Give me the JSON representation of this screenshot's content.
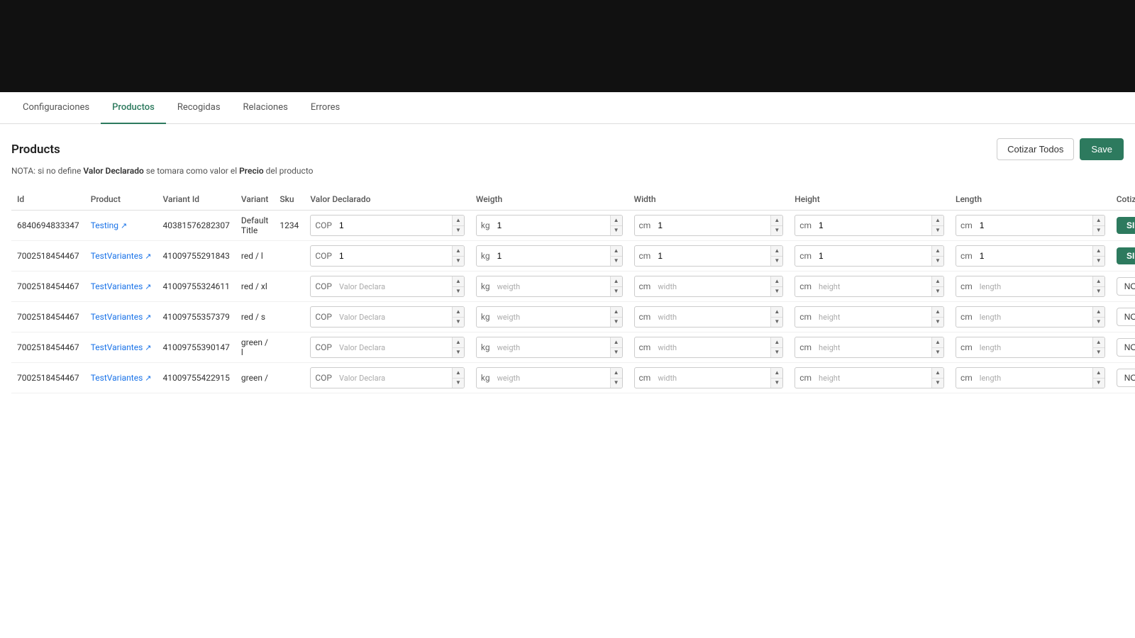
{
  "topBar": {},
  "nav": {
    "tabs": [
      {
        "id": "configuraciones",
        "label": "Configuraciones",
        "active": false
      },
      {
        "id": "productos",
        "label": "Productos",
        "active": true
      },
      {
        "id": "recogidas",
        "label": "Recogidas",
        "active": false
      },
      {
        "id": "relaciones",
        "label": "Relaciones",
        "active": false
      },
      {
        "id": "errores",
        "label": "Errores",
        "active": false
      }
    ]
  },
  "page": {
    "title": "Products",
    "nota_prefix": "NOTA: si no define ",
    "nota_bold1": "Valor Declarado",
    "nota_mid": " se tomara como valor el ",
    "nota_bold2": "Precio",
    "nota_suffix": " del producto",
    "btn_cotizar": "Cotizar Todos",
    "btn_save": "Save"
  },
  "table": {
    "headers": [
      "Id",
      "Product",
      "Variant Id",
      "Variant",
      "Sku",
      "Valor Declarado",
      "Weigth",
      "Width",
      "Height",
      "Length",
      "Cotizable"
    ],
    "rows": [
      {
        "id": "6840694833347",
        "product": "Testing",
        "product_link": true,
        "variant_id": "40381576282307",
        "variant": "Default Title",
        "sku": "1234",
        "valor_unit": "COP",
        "valor_value": "1",
        "valor_placeholder": "",
        "weigth_unit": "kg",
        "weigth_value": "1",
        "weigth_placeholder": "",
        "width_unit": "cm",
        "width_value": "1",
        "width_placeholder": "",
        "height_unit": "cm",
        "height_value": "1",
        "height_placeholder": "",
        "length_unit": "cm",
        "length_value": "1",
        "length_placeholder": "",
        "cotizable": "SI",
        "cotizable_active": true
      },
      {
        "id": "7002518454467",
        "product": "TestVariantes",
        "product_link": true,
        "variant_id": "41009755291843",
        "variant": "red / l",
        "sku": "",
        "valor_unit": "COP",
        "valor_value": "1",
        "valor_placeholder": "",
        "weigth_unit": "kg",
        "weigth_value": "1",
        "weigth_placeholder": "",
        "width_unit": "cm",
        "width_value": "1",
        "width_placeholder": "",
        "height_unit": "cm",
        "height_value": "1",
        "height_placeholder": "",
        "length_unit": "cm",
        "length_value": "1",
        "length_placeholder": "",
        "cotizable": "SI",
        "cotizable_active": true
      },
      {
        "id": "7002518454467",
        "product": "TestVariantes",
        "product_link": true,
        "variant_id": "41009755324611",
        "variant": "red / xl",
        "sku": "",
        "valor_unit": "COP",
        "valor_value": "",
        "valor_placeholder": "Valor Declara",
        "weigth_unit": "kg",
        "weigth_value": "",
        "weigth_placeholder": "weigth",
        "width_unit": "cm",
        "width_value": "",
        "width_placeholder": "width",
        "height_unit": "cm",
        "height_value": "",
        "height_placeholder": "height",
        "length_unit": "cm",
        "length_value": "",
        "length_placeholder": "length",
        "cotizable": "NO",
        "cotizable_active": false
      },
      {
        "id": "7002518454467",
        "product": "TestVariantes",
        "product_link": true,
        "variant_id": "41009755357379",
        "variant": "red / s",
        "sku": "",
        "valor_unit": "COP",
        "valor_value": "",
        "valor_placeholder": "Valor Declara",
        "weigth_unit": "kg",
        "weigth_value": "",
        "weigth_placeholder": "weigth",
        "width_unit": "cm",
        "width_value": "",
        "width_placeholder": "width",
        "height_unit": "cm",
        "height_value": "",
        "height_placeholder": "height",
        "length_unit": "cm",
        "length_value": "",
        "length_placeholder": "length",
        "cotizable": "NO",
        "cotizable_active": false
      },
      {
        "id": "7002518454467",
        "product": "TestVariantes",
        "product_link": true,
        "variant_id": "41009755390147",
        "variant": "green / l",
        "sku": "",
        "valor_unit": "COP",
        "valor_value": "",
        "valor_placeholder": "Valor Declara",
        "weigth_unit": "kg",
        "weigth_value": "",
        "weigth_placeholder": "weigth",
        "width_unit": "cm",
        "width_value": "",
        "width_placeholder": "width",
        "height_unit": "cm",
        "height_value": "",
        "height_placeholder": "height",
        "length_unit": "cm",
        "length_value": "",
        "length_placeholder": "length",
        "cotizable": "NO",
        "cotizable_active": false
      },
      {
        "id": "7002518454467",
        "product": "TestVariantes",
        "product_link": true,
        "variant_id": "41009755422915",
        "variant": "green /",
        "sku": "",
        "valor_unit": "COP",
        "valor_value": "",
        "valor_placeholder": "Valor Declara",
        "weigth_unit": "kg",
        "weigth_value": "",
        "weigth_placeholder": "weigth",
        "width_unit": "cm",
        "width_value": "",
        "width_placeholder": "width",
        "height_unit": "cm",
        "height_value": "",
        "height_placeholder": "height",
        "length_unit": "cm",
        "length_value": "",
        "length_placeholder": "length",
        "cotizable": "NO",
        "cotizable_active": false
      }
    ]
  }
}
